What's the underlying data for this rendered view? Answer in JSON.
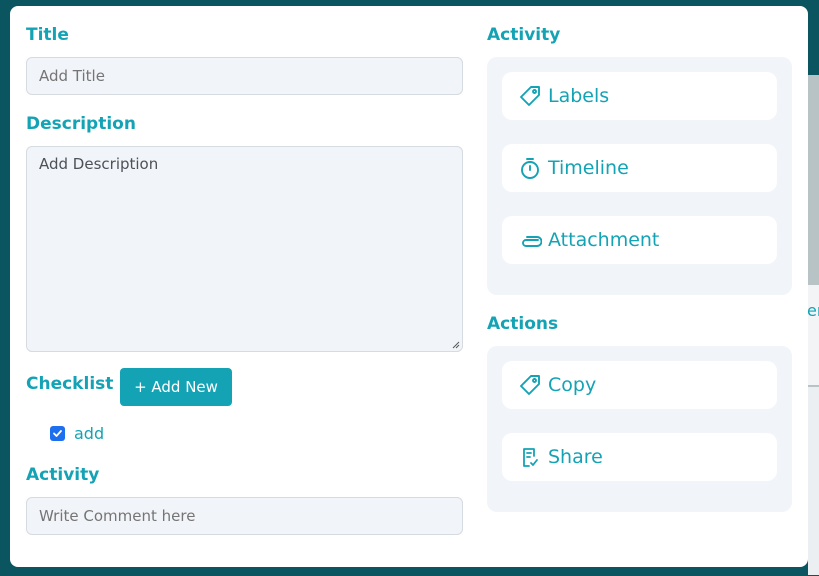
{
  "form": {
    "title_label": "Title",
    "title_placeholder": "Add Title",
    "description_label": "Description",
    "description_value": "Add Description",
    "checklist_label": "Checklist",
    "add_new_label": "+ Add New",
    "checklist_items": [
      {
        "label": "add",
        "checked": true
      }
    ],
    "activity_label": "Activity",
    "comment_placeholder": "Write Comment here"
  },
  "activity_panel": {
    "heading": "Activity",
    "items": [
      {
        "label": "Labels",
        "icon": "tag-icon"
      },
      {
        "label": "Timeline",
        "icon": "stopwatch-icon"
      },
      {
        "label": "Attachment",
        "icon": "paperclip-icon"
      }
    ]
  },
  "actions_panel": {
    "heading": "Actions",
    "items": [
      {
        "label": "Copy",
        "icon": "tag-icon"
      },
      {
        "label": "Share",
        "icon": "document-check-icon"
      }
    ]
  },
  "background": {
    "fragment_text": "er"
  },
  "colors": {
    "accent": "#14a3b5",
    "checkbox": "#1e6ff0",
    "backdrop": "#0b5560"
  }
}
